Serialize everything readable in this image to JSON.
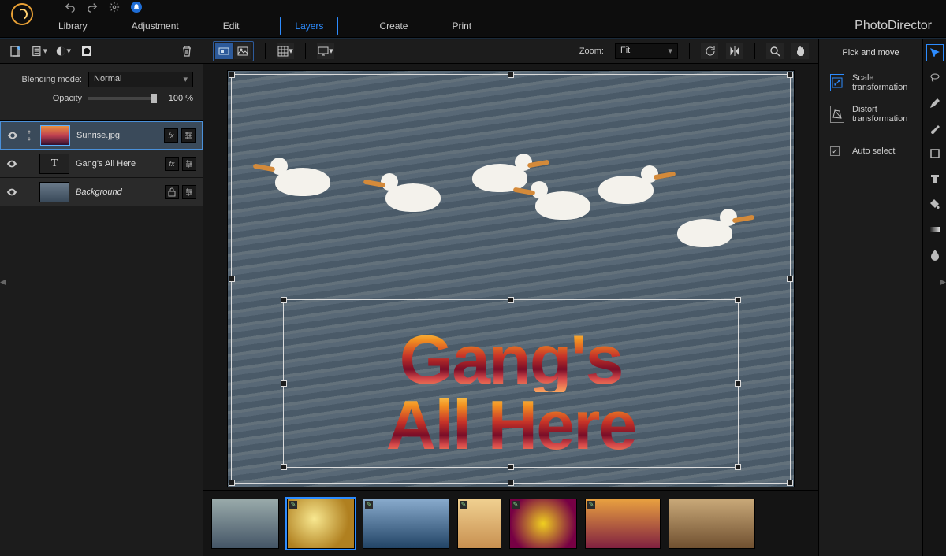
{
  "app": {
    "brand": "PhotoDirector"
  },
  "tabs": [
    "Library",
    "Adjustment",
    "Edit",
    "Layers",
    "Create",
    "Print"
  ],
  "tabs_active_index": 3,
  "left": {
    "blend_label": "Blending mode:",
    "blend_value": "Normal",
    "opacity_label": "Opacity",
    "opacity_value": "100 %",
    "layers": [
      {
        "name": "Sunrise.jpg",
        "type": "image",
        "selected": true,
        "fx": true,
        "adjust": true,
        "locked": false
      },
      {
        "name": "Gang's All Here",
        "type": "text",
        "selected": false,
        "fx": true,
        "adjust": true,
        "locked": false
      },
      {
        "name": "Background",
        "type": "image",
        "selected": false,
        "fx": false,
        "adjust": true,
        "locked": true
      }
    ]
  },
  "center": {
    "zoom_label": "Zoom:",
    "zoom_value": "Fit",
    "text_line1": "Gang's",
    "text_line2": "All Here"
  },
  "right": {
    "title": "Pick and move",
    "opt_scale": "Scale transformation",
    "opt_distort": "Distort transformation",
    "auto_select": "Auto select",
    "auto_select_checked": true
  },
  "icons": {
    "search": "search-icon"
  }
}
